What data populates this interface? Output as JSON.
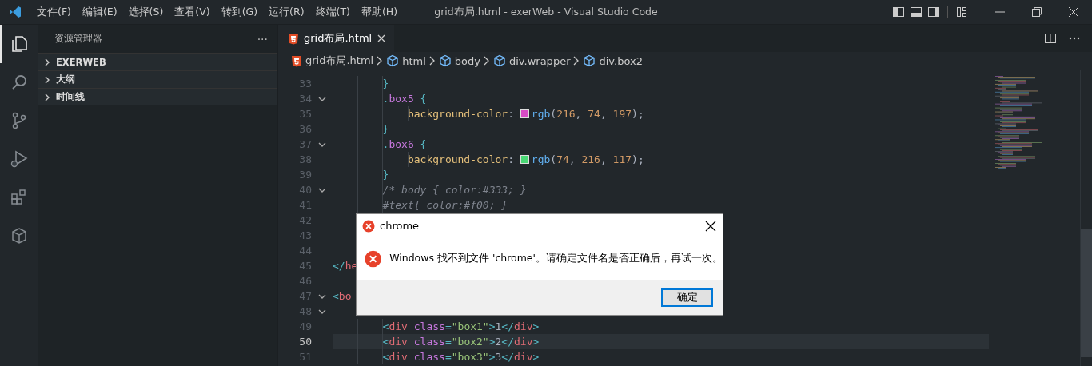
{
  "title_bar": {
    "menus": [
      "文件(F)",
      "编辑(E)",
      "选择(S)",
      "查看(V)",
      "转到(G)",
      "运行(R)",
      "终端(T)",
      "帮助(H)"
    ],
    "title": "grid布局.html - exerWeb - Visual Studio Code"
  },
  "activity_bar": [
    {
      "kind": "files",
      "selected": true
    },
    {
      "kind": "search",
      "selected": false
    },
    {
      "kind": "source",
      "selected": false
    },
    {
      "kind": "debug",
      "selected": false
    },
    {
      "kind": "extensions",
      "selected": false
    },
    {
      "kind": "package",
      "selected": false
    }
  ],
  "sidebar": {
    "title": "资源管理器",
    "more": "···",
    "sections": [
      {
        "label": "EXERWEB",
        "expanded": false
      },
      {
        "label": "大纲",
        "expanded": false
      },
      {
        "label": "时间线",
        "expanded": false
      }
    ]
  },
  "tabs": [
    {
      "label": "grid布局.html",
      "selected": true
    }
  ],
  "breadcrumbs": [
    {
      "label": "grid布局.html",
      "kind": "file"
    },
    {
      "label": "html",
      "kind": "symbol"
    },
    {
      "label": "body",
      "kind": "symbol"
    },
    {
      "label": "div.wrapper",
      "kind": "symbol"
    },
    {
      "label": "div.box2",
      "kind": "symbol"
    }
  ],
  "code_lines": [
    {
      "number": "33",
      "fold": false,
      "current": false,
      "tokens": [
        {
          "text": "        }",
          "kind": "brace"
        }
      ]
    },
    {
      "number": "34",
      "fold": true,
      "current": false,
      "tokens": [
        {
          "text": "        .",
          "kind": "brace"
        },
        {
          "text": "box5",
          "kind": "selector"
        },
        {
          "text": " {",
          "kind": "brace"
        }
      ]
    },
    {
      "number": "35",
      "fold": false,
      "current": false,
      "tokens": [
        {
          "text": "            background-color",
          "kind": "property"
        },
        {
          "text": ": ",
          "kind": "plain"
        },
        {
          "kind": "swatch",
          "color": "#d84ac5"
        },
        {
          "text": "rgb",
          "kind": "function"
        },
        {
          "text": "(",
          "kind": "plain"
        },
        {
          "text": "216",
          "kind": "number"
        },
        {
          "text": ", ",
          "kind": "plain"
        },
        {
          "text": "74",
          "kind": "number"
        },
        {
          "text": ", ",
          "kind": "plain"
        },
        {
          "text": "197",
          "kind": "number"
        },
        {
          "text": ");",
          "kind": "plain"
        }
      ]
    },
    {
      "number": "36",
      "fold": false,
      "current": false,
      "tokens": [
        {
          "text": "        }",
          "kind": "brace"
        }
      ]
    },
    {
      "number": "37",
      "fold": true,
      "current": false,
      "tokens": [
        {
          "text": "        .",
          "kind": "brace"
        },
        {
          "text": "box6",
          "kind": "selector"
        },
        {
          "text": " {",
          "kind": "brace"
        }
      ]
    },
    {
      "number": "38",
      "fold": false,
      "current": false,
      "tokens": [
        {
          "text": "            background-color",
          "kind": "property"
        },
        {
          "text": ": ",
          "kind": "plain"
        },
        {
          "kind": "swatch",
          "color": "#4ad875"
        },
        {
          "text": "rgb",
          "kind": "function"
        },
        {
          "text": "(",
          "kind": "plain"
        },
        {
          "text": "74",
          "kind": "number"
        },
        {
          "text": ", ",
          "kind": "plain"
        },
        {
          "text": "216",
          "kind": "number"
        },
        {
          "text": ", ",
          "kind": "plain"
        },
        {
          "text": "117",
          "kind": "number"
        },
        {
          "text": ");",
          "kind": "plain"
        }
      ]
    },
    {
      "number": "39",
      "fold": false,
      "current": false,
      "tokens": [
        {
          "text": "        }",
          "kind": "brace"
        }
      ]
    },
    {
      "number": "40",
      "fold": true,
      "current": false,
      "tokens": [
        {
          "text": "        /* body { color:#333; }",
          "kind": "comment"
        }
      ]
    },
    {
      "number": "41",
      "fold": false,
      "current": false,
      "tokens": [
        {
          "text": "        #text{ color:#f00; }",
          "kind": "comment"
        }
      ]
    },
    {
      "number": "42",
      "fold": false,
      "current": false
    },
    {
      "number": "43",
      "fold": false,
      "current": false
    },
    {
      "number": "44",
      "fold": false,
      "current": false
    },
    {
      "number": "45",
      "fold": false,
      "current": false,
      "tokens": [
        {
          "text": "</",
          "kind": "brace"
        },
        {
          "text": "he",
          "kind": "tag"
        }
      ]
    },
    {
      "number": "46",
      "fold": false,
      "current": false
    },
    {
      "number": "47",
      "fold": true,
      "current": false,
      "tokens": [
        {
          "text": "<",
          "kind": "brace"
        },
        {
          "text": "bo",
          "kind": "tag"
        }
      ]
    },
    {
      "number": "48",
      "fold": true,
      "current": false
    },
    {
      "number": "49",
      "fold": false,
      "current": false,
      "tokens": [
        {
          "text": "        <",
          "kind": "brace"
        },
        {
          "text": "div",
          "kind": "tag"
        },
        {
          "text": " class",
          "kind": "attr"
        },
        {
          "text": "=",
          "kind": "brace"
        },
        {
          "text": "\"box1\"",
          "kind": "string"
        },
        {
          "text": ">",
          "kind": "brace"
        },
        {
          "text": "1",
          "kind": "plain"
        },
        {
          "text": "</",
          "kind": "brace"
        },
        {
          "text": "div",
          "kind": "tag"
        },
        {
          "text": ">",
          "kind": "brace"
        }
      ]
    },
    {
      "number": "50",
      "fold": false,
      "current": true,
      "tokens": [
        {
          "text": "        <",
          "kind": "brace"
        },
        {
          "text": "div",
          "kind": "tag"
        },
        {
          "text": " class",
          "kind": "attr"
        },
        {
          "text": "=",
          "kind": "brace"
        },
        {
          "text": "\"box2\"",
          "kind": "string"
        },
        {
          "text": ">",
          "kind": "brace"
        },
        {
          "text": "2",
          "kind": "plain"
        },
        {
          "text": "</",
          "kind": "brace"
        },
        {
          "text": "div",
          "kind": "tag"
        },
        {
          "text": ">",
          "kind": "brace"
        }
      ]
    },
    {
      "number": "51",
      "fold": false,
      "current": false,
      "tokens": [
        {
          "text": "        <",
          "kind": "brace"
        },
        {
          "text": "div",
          "kind": "tag"
        },
        {
          "text": " class",
          "kind": "attr"
        },
        {
          "text": "=",
          "kind": "brace"
        },
        {
          "text": "\"box3\"",
          "kind": "string"
        },
        {
          "text": ">",
          "kind": "brace"
        },
        {
          "text": "3",
          "kind": "plain"
        },
        {
          "text": "</",
          "kind": "brace"
        },
        {
          "text": "div",
          "kind": "tag"
        },
        {
          "text": ">",
          "kind": "brace"
        }
      ]
    }
  ],
  "dialog": {
    "title": "chrome",
    "message": "Windows 找不到文件 'chrome'。请确定文件名是否正确后，再试一次。",
    "buttons": [
      "确定"
    ]
  }
}
